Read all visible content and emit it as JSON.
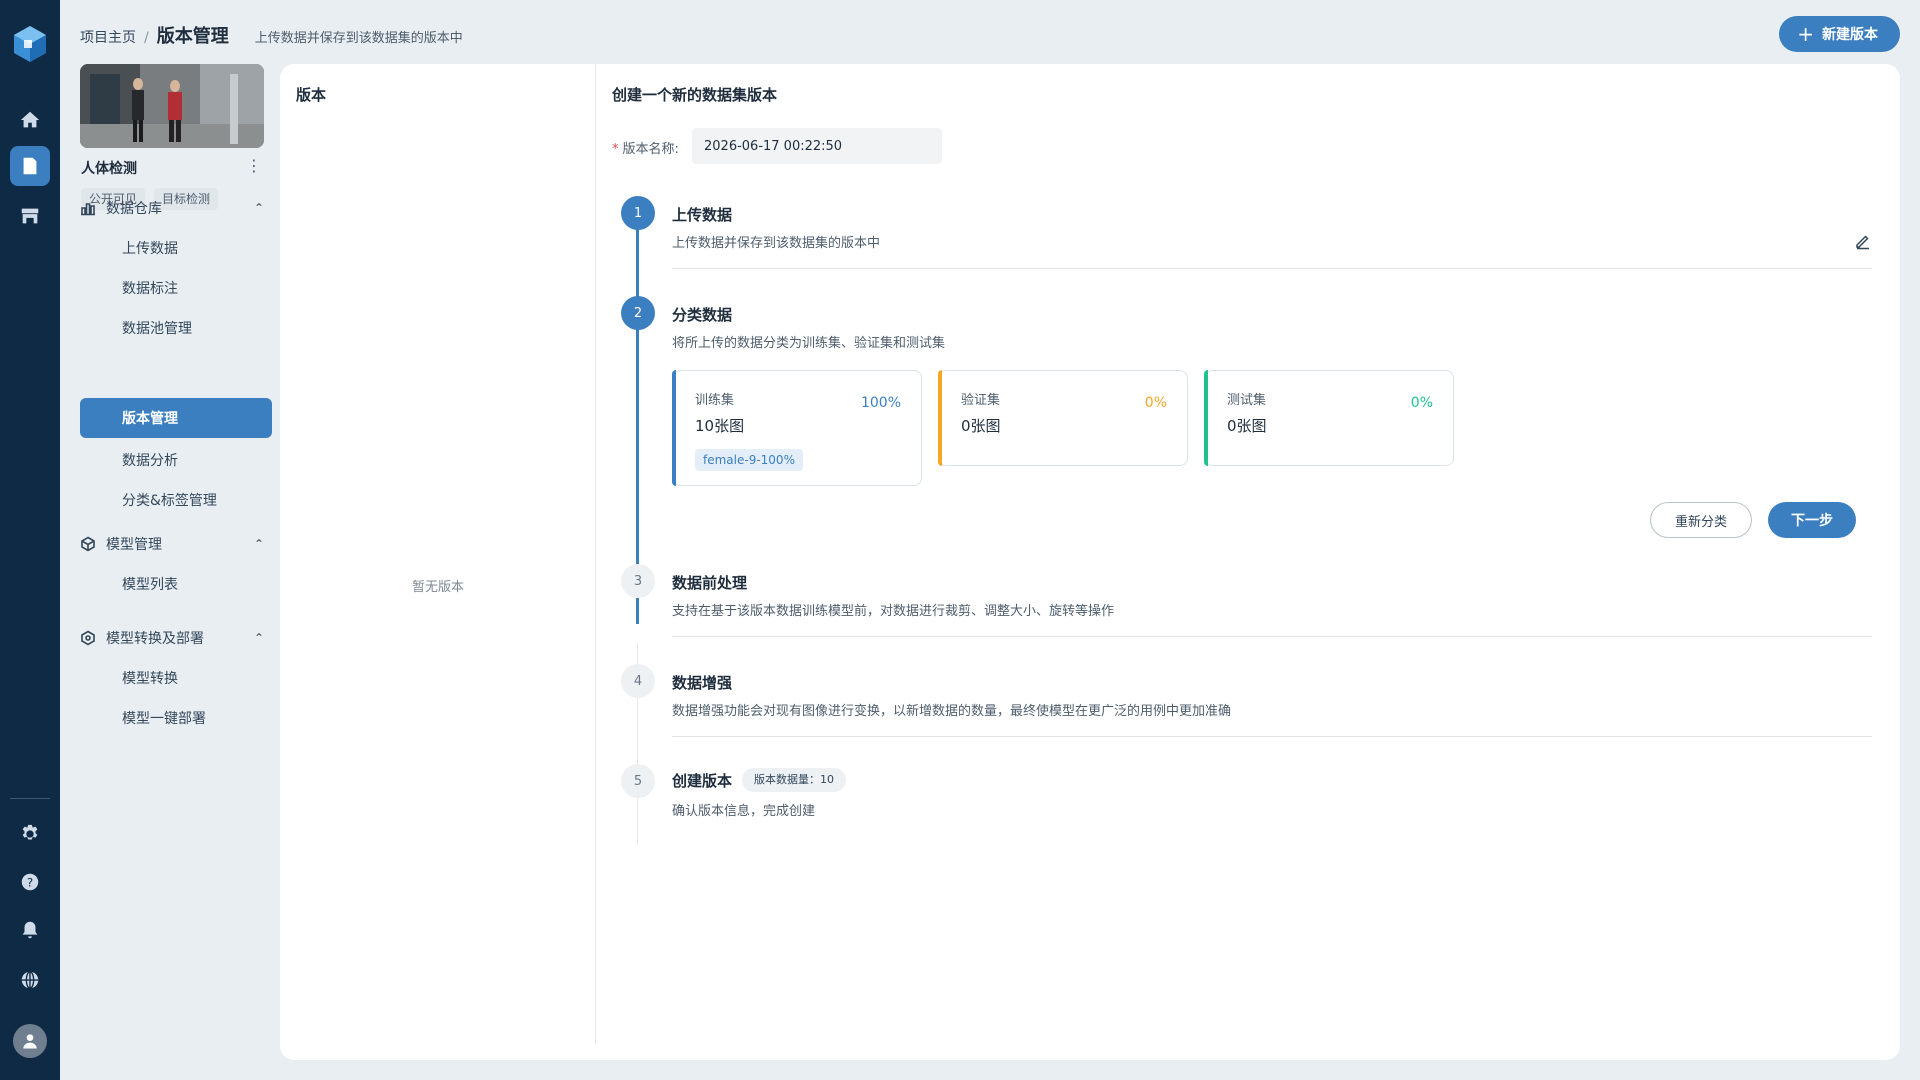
{
  "topbar": {
    "breadcrumb_home": "项目主页",
    "breadcrumb_sep": "/",
    "breadcrumb_current": "版本管理",
    "page_desc": "上传数据并保存到该数据集的版本中",
    "new_version_label": "新建版本"
  },
  "project": {
    "name": "人体检测",
    "more": "⋮",
    "tags": [
      "公开可见",
      "目标检测"
    ]
  },
  "nav": {
    "groups": [
      {
        "label": "数据仓库",
        "icon": "bar-chart-icon",
        "chevron": "⌃"
      },
      {
        "label": "模型管理",
        "icon": "cube-icon",
        "chevron": "⌃"
      },
      {
        "label": "模型转换及部署",
        "icon": "hexagon-icon",
        "chevron": "⌃"
      }
    ],
    "items": [
      "上传数据",
      "数据标注",
      "数据池管理",
      "版本管理",
      "数据分析",
      "分类&标签管理",
      "模型列表",
      "模型转换",
      "模型一键部署"
    ],
    "active_item": "版本管理"
  },
  "rail": {
    "icons": [
      "logo-icon",
      "home-icon",
      "dataset-icon",
      "store-icon",
      "settings-icon",
      "help-icon",
      "bell-icon",
      "globe-icon",
      "user-avatar-icon"
    ]
  },
  "versions_panel": {
    "title": "版本",
    "empty_text": "暂无版本"
  },
  "create_panel": {
    "title": "创建一个新的数据集版本",
    "version_name_label": "版本名称:",
    "required_mark": "*",
    "version_name_value": "2026-06-17 00:22:50"
  },
  "steps": [
    {
      "num": "1",
      "title": "上传数据",
      "desc": "上传数据并保存到该数据集的版本中",
      "state": "done"
    },
    {
      "num": "2",
      "title": "分类数据",
      "desc": "将所上传的数据分类为训练集、验证集和测试集",
      "state": "done"
    },
    {
      "num": "3",
      "title": "数据前处理",
      "desc": "支持在基于该版本数据训练模型前，对数据进行裁剪、调整大小、旋转等操作",
      "state": "todo"
    },
    {
      "num": "4",
      "title": "数据增强",
      "desc": "数据增强功能会对现有图像进行变换，以新增数据的数量，最终使模型在更广泛的用例中更加准确",
      "state": "todo"
    },
    {
      "num": "5",
      "title": "创建版本",
      "desc": "确认版本信息，完成创建",
      "state": "todo",
      "badge": "版本数据量：10"
    }
  ],
  "splits": [
    {
      "name": "训练集",
      "percent": "100%",
      "count": "10张图",
      "chip": "female-9-100%",
      "color": "#3b7fc0"
    },
    {
      "name": "验证集",
      "percent": "0%",
      "count": "0张图",
      "color": "#f5a623"
    },
    {
      "name": "测试集",
      "percent": "0%",
      "count": "0张图",
      "color": "#1fc28f"
    }
  ],
  "actions": {
    "reclassify_label": "重新分类",
    "next_label": "下一步"
  }
}
